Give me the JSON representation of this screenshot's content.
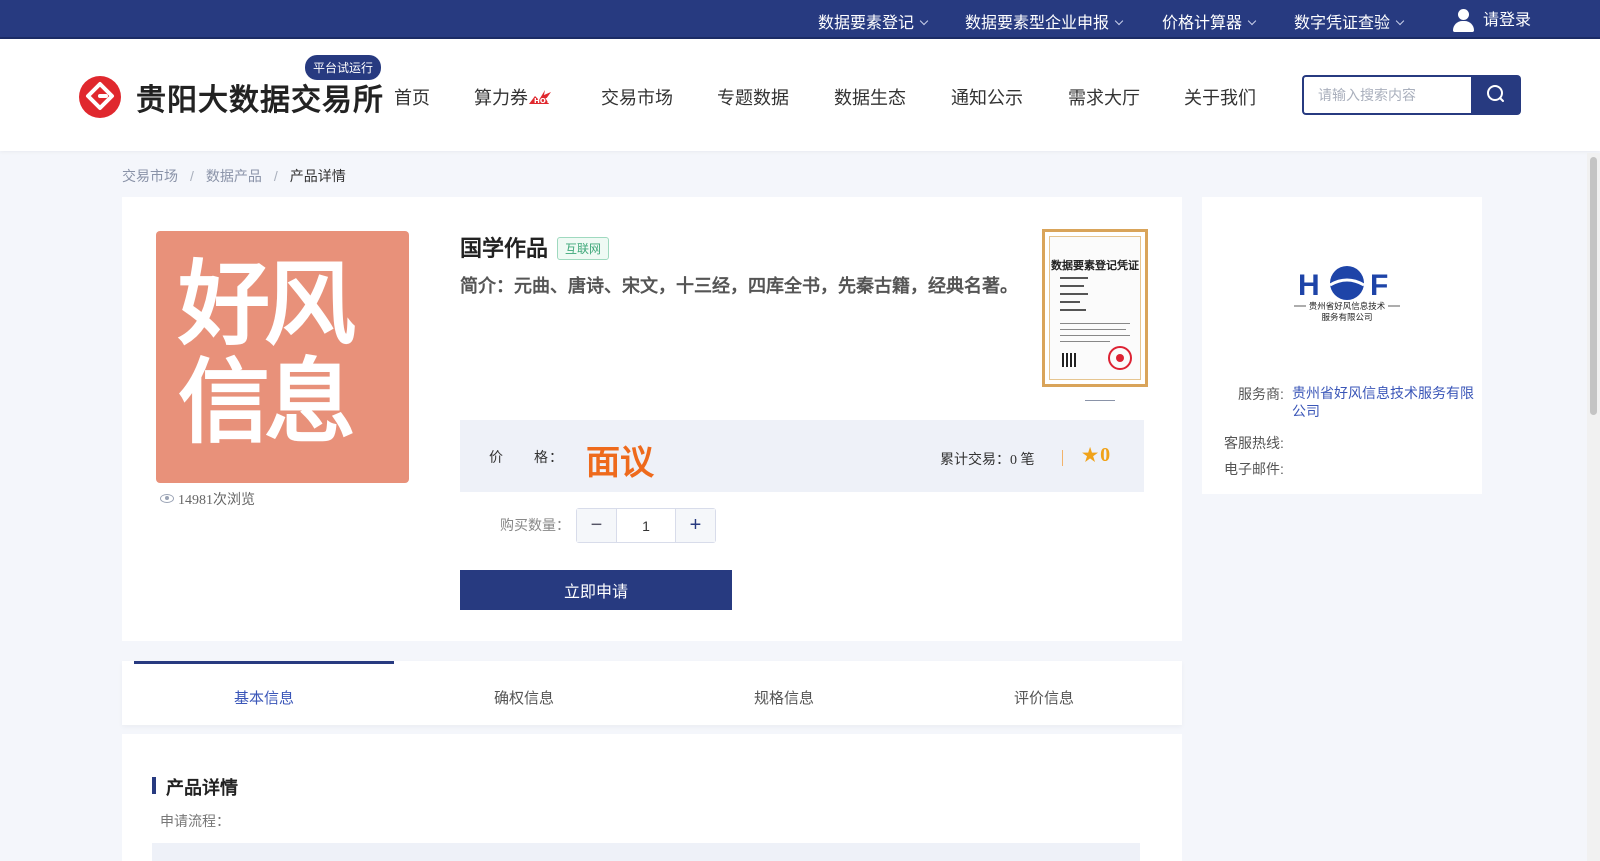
{
  "topbar": {
    "links": [
      {
        "label": "数据要素登记"
      },
      {
        "label": "数据要素型企业申报"
      },
      {
        "label": "价格计算器"
      },
      {
        "label": "数字凭证查验"
      }
    ],
    "login_label": "请登录"
  },
  "header": {
    "brand": "贵阳大数据交易所",
    "badge": "平台试运行",
    "nav": [
      {
        "label": "首页"
      },
      {
        "label": "算力券",
        "badge": "HOT"
      },
      {
        "label": "交易市场"
      },
      {
        "label": "专题数据"
      },
      {
        "label": "数据生态"
      },
      {
        "label": "通知公示"
      },
      {
        "label": "需求大厅"
      },
      {
        "label": "关于我们"
      }
    ],
    "search": {
      "placeholder": "请输入搜索内容",
      "value": ""
    }
  },
  "breadcrumb": {
    "items": [
      "交易市场",
      "数据产品",
      "产品详情"
    ],
    "separator": "/"
  },
  "product": {
    "image_text_line1": "好风",
    "image_text_line2": "信息",
    "views": "14981次浏览",
    "title": "国学作品",
    "tag": "互联网",
    "intro": "简介：元曲、唐诗、宋文，十三经，四库全书，先秦古籍，经典名著。",
    "certificate_title": "数据要素登记凭证",
    "price_label": "价　　格：",
    "price_value": "面议",
    "deals": "累计交易：0 笔",
    "rating": "0",
    "quantity_label": "购买数量：",
    "quantity": "1",
    "apply_label": "立即申请"
  },
  "provider": {
    "logo_subtitle_1": "贵州省好风信息技术",
    "logo_subtitle_2": "服务有限公司",
    "service_label": "服务商:",
    "service_value_1": "贵州省好风信息技术服务有限",
    "service_value_2": "公司",
    "hotline_label": "客服热线:",
    "email_label": "电子邮件:"
  },
  "tabs": [
    {
      "label": "基本信息",
      "active": true
    },
    {
      "label": "确权信息",
      "active": false
    },
    {
      "label": "规格信息",
      "active": false
    },
    {
      "label": "评价信息",
      "active": false
    }
  ],
  "details": {
    "title": "产品详情",
    "process_label": "申请流程："
  },
  "colors": {
    "primary": "#273a80",
    "price": "#ee6a1c",
    "product_image_bg": "#e8917a",
    "logo_red": "#e0282e",
    "link_blue": "#3a56b8"
  }
}
